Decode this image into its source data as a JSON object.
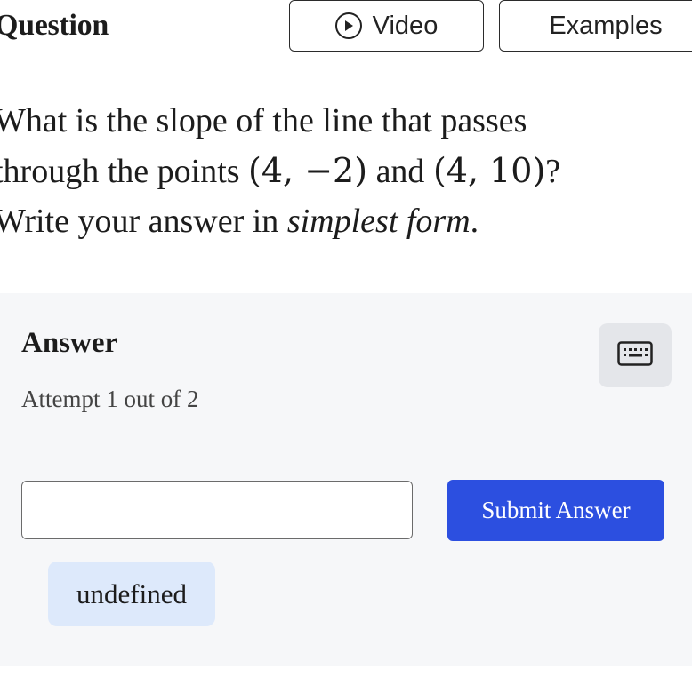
{
  "header": {
    "title": "Question",
    "video_label": "Video",
    "examples_label": "Examples"
  },
  "question": {
    "line1": "What is the slope of the line that passes",
    "line2_prefix": "through the points ",
    "point1": "(4, −2)",
    "conjunction": " and ",
    "point2": "(4, 10)",
    "line2_suffix": "?",
    "line3_prefix": "Write your answer in ",
    "line3_emphasis": "simplest form",
    "line3_suffix": "."
  },
  "answer": {
    "label": "Answer",
    "attempt": "Attempt 1 out of 2",
    "input_value": "",
    "submit_label": "Submit Answer",
    "chip_label": "undefined"
  },
  "icons": {
    "video": "play-circle-icon",
    "keyboard": "keyboard-icon"
  },
  "colors": {
    "submit_bg": "#2c4fe0",
    "chip_bg": "#dde9fb",
    "panel_bg": "#f6f7f9"
  }
}
